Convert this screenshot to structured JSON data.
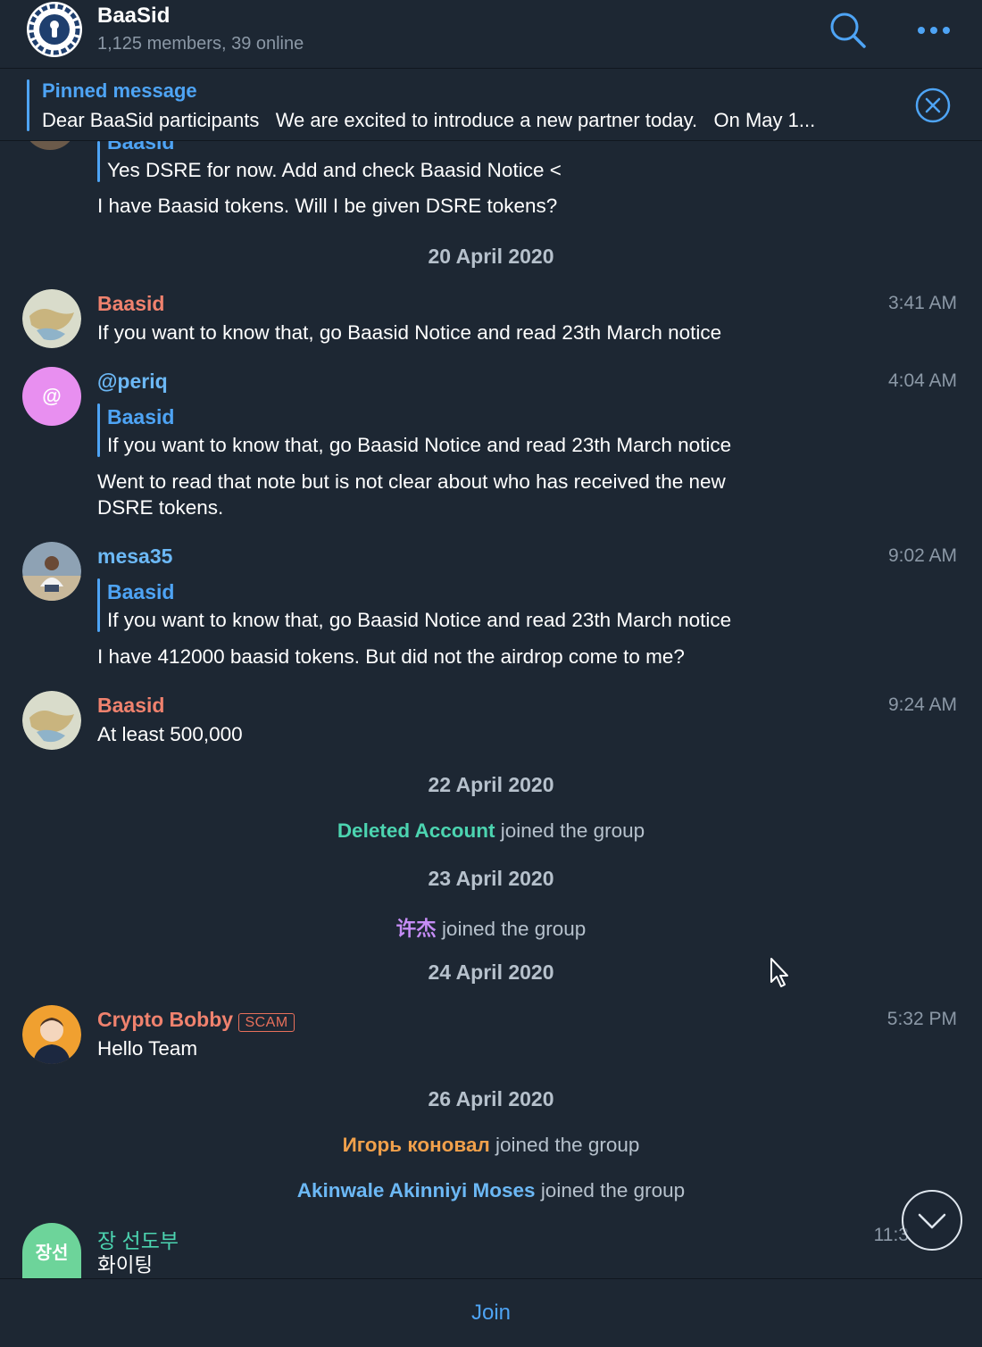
{
  "header": {
    "title": "BaaSid",
    "subtitle": "1,125 members, 39 online",
    "search_icon": "search-icon",
    "more_icon": "more-dots-icon"
  },
  "pinned": {
    "title": "Pinned message",
    "text": "Dear BaaSid participants   We are excited to introduce a new partner today.   On May 1...",
    "close_icon": "close-circle-icon"
  },
  "chat": {
    "top_partial": {
      "reply_name": "Baasid",
      "reply_text": "Yes DSRE for now. Add and check Baasid Notice <",
      "text": "I have Baasid tokens. Will I be given DSRE tokens?"
    },
    "dates": [
      "20 April 2020",
      "22 April 2020",
      "23 April 2020",
      "24 April 2020",
      "26 April 2020"
    ],
    "messages": [
      {
        "sender": "Baasid",
        "time": "3:41 AM",
        "text": "If you want to know that, go Baasid Notice and read 23th March notice"
      },
      {
        "sender": "@periq",
        "time": "4:04 AM",
        "avatar_letter": "@",
        "reply_name": "Baasid",
        "reply_text": "If you want to know that, go Baasid Notice and read 23th March notice",
        "text_line1": "Went to read that note but is not clear about who has received the new",
        "text_line2": "DSRE tokens."
      },
      {
        "sender": "mesa35",
        "time": "9:02 AM",
        "reply_name": "Baasid",
        "reply_text": "If you want to know that, go Baasid Notice and read 23th March notice",
        "text": "I have 412000 baasid tokens. But did not the airdrop come to me?"
      },
      {
        "sender": "Baasid",
        "time": "9:24 AM",
        "text": "At least 500,000"
      },
      {
        "sender": "Crypto Bobby",
        "badge": "SCAM",
        "time": "5:32 PM",
        "text": "Hello Team"
      },
      {
        "sender": "장 선도부",
        "avatar_letter": "장선",
        "time": "11:3",
        "text": "화이팅"
      }
    ],
    "service": [
      {
        "name": "Deleted Account",
        "text": "joined the group",
        "color": "#4cd4b0"
      },
      {
        "name": "许杰",
        "text": "joined the group",
        "color": "#c58cf5"
      },
      {
        "name": "Игорь коновал",
        "text": "joined the group",
        "color": "#f0a04b"
      },
      {
        "name": "Akinwale Akinniyi Moses",
        "text": "joined the group",
        "color": "#6cb8f5"
      }
    ]
  },
  "bottom": {
    "join_label": "Join",
    "scroll_icon": "chevron-down-icon"
  },
  "colors": {
    "accent": "#4ea4f5",
    "background": "#1d2733",
    "baasid_name": "#f0826e",
    "mesa_name": "#6cb8f5"
  }
}
